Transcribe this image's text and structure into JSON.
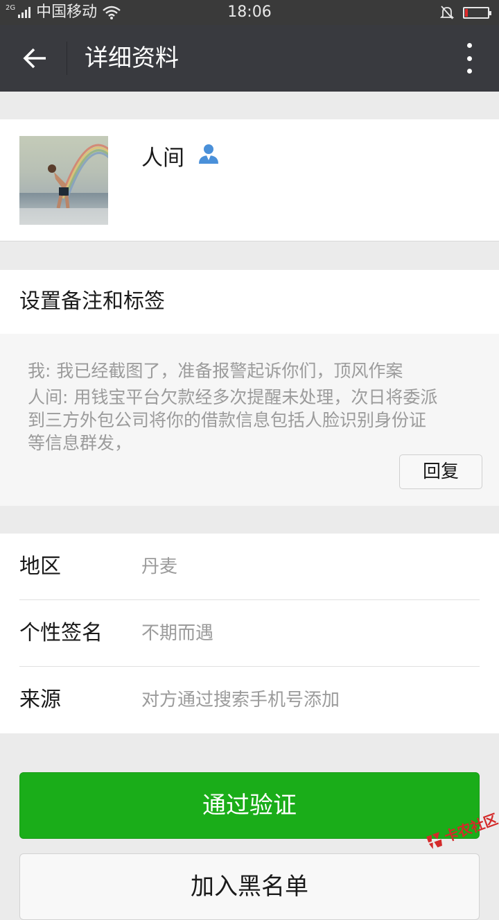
{
  "status_bar": {
    "network_type": "2G",
    "carrier": "中国移动",
    "time": "18:06"
  },
  "app_bar": {
    "title": "详细资料",
    "icons": {
      "back": "arrow-left-icon",
      "more": "more-vertical-icon"
    }
  },
  "profile": {
    "name": "人间",
    "avatar": "avatar-photo-beach-rainbow",
    "badge_icon": "person-icon"
  },
  "remark": {
    "label": "设置备注和标签"
  },
  "messages": {
    "lines": [
      "我: 我已经截图了，准备报警起诉你们，顶风作案",
      "人间: 用钱宝平台欠款经多次提醒未处理，次日将委派",
      "到三方外包公司将你的借款信息包括人脸识别身份证",
      "等信息群发，"
    ],
    "reply_label": "回复"
  },
  "info": {
    "rows": [
      {
        "label": "地区",
        "value": "丹麦"
      },
      {
        "label": "个性签名",
        "value": "不期而遇"
      },
      {
        "label": "来源",
        "value": "对方通过搜索手机号添加"
      }
    ]
  },
  "actions": {
    "verify_label": "通过验证",
    "blacklist_label": "加入黑名单"
  },
  "watermark": {
    "text": "卡农社区"
  },
  "colors": {
    "app_bar": "#393a3f",
    "status_bar": "#3a3a3a",
    "primary_green": "#1aad19",
    "page_bg": "#ebebeb",
    "battery_low": "#e02b2b",
    "person_icon": "#4a90d9"
  }
}
